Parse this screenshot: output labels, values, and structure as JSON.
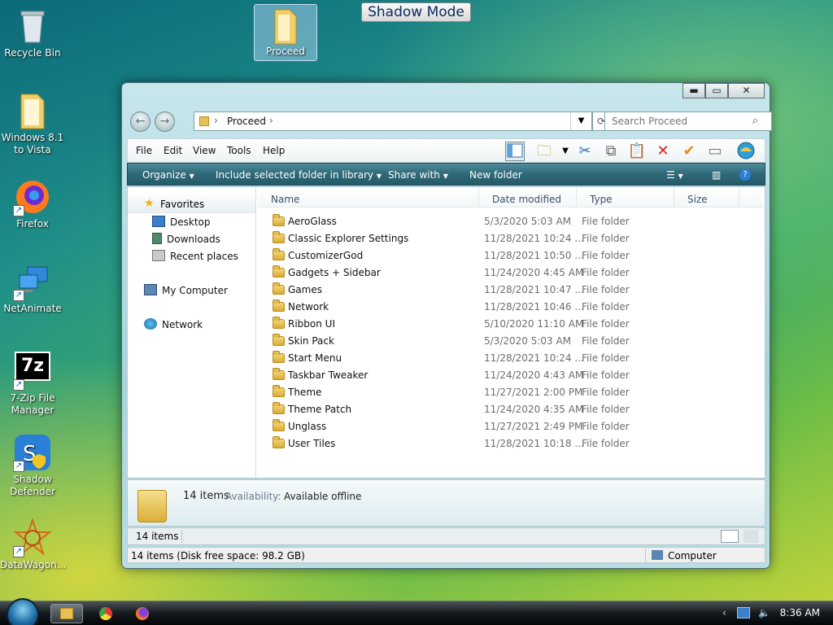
{
  "desktop": {
    "icons": [
      {
        "label": "Recycle Bin",
        "icon": "recycle-bin-icon"
      },
      {
        "label": "Windows 8.1 to Vista",
        "icon": "folder-icon"
      },
      {
        "label": "Firefox",
        "icon": "firefox-icon"
      },
      {
        "label": "NetAnimate",
        "icon": "network-computers-icon"
      },
      {
        "label": "7-Zip File Manager",
        "icon": "7zip-icon",
        "glyph": "7z"
      },
      {
        "label": "Shadow Defender",
        "icon": "shadow-defender-icon"
      },
      {
        "label": "DataWagon...",
        "icon": "datawagon-icon"
      },
      {
        "label": "Proceed",
        "icon": "folder-icon"
      }
    ],
    "shadow_mode": "Shadow Mode"
  },
  "window": {
    "controls": {
      "minimize": "▬",
      "maximize": "▭",
      "close": "✕"
    },
    "address": {
      "crumb": "Proceed",
      "separator": "›"
    },
    "search_placeholder": "Search Proceed",
    "menu": [
      "File",
      "Edit",
      "View",
      "Tools",
      "Help"
    ],
    "commands": [
      "Organize",
      "Include selected folder in library",
      "Share with",
      "New folder"
    ],
    "nav": {
      "favorites": "Favorites",
      "items": [
        "Desktop",
        "Downloads",
        "Recent places"
      ],
      "my_computer": "My Computer",
      "network": "Network"
    },
    "columns": [
      "Name",
      "Date modified",
      "Type",
      "Size"
    ],
    "files": [
      {
        "name": "AeroGlass",
        "date": "5/3/2020 5:03 AM",
        "type": "File folder"
      },
      {
        "name": "Classic Explorer Settings",
        "date": "11/28/2021 10:24 ...",
        "type": "File folder"
      },
      {
        "name": "CustomizerGod",
        "date": "11/28/2021 10:50 ...",
        "type": "File folder"
      },
      {
        "name": "Gadgets + Sidebar",
        "date": "11/24/2020 4:45 AM",
        "type": "File folder"
      },
      {
        "name": "Games",
        "date": "11/28/2021 10:47 ...",
        "type": "File folder"
      },
      {
        "name": "Network",
        "date": "11/28/2021 10:46 ...",
        "type": "File folder"
      },
      {
        "name": "Ribbon UI",
        "date": "5/10/2020 11:10 AM",
        "type": "File folder"
      },
      {
        "name": "Skin Pack",
        "date": "5/3/2020 5:03 AM",
        "type": "File folder"
      },
      {
        "name": "Start Menu",
        "date": "11/28/2021 10:24 ...",
        "type": "File folder"
      },
      {
        "name": "Taskbar Tweaker",
        "date": "11/24/2020 4:43 AM",
        "type": "File folder"
      },
      {
        "name": "Theme",
        "date": "11/27/2021 2:00 PM",
        "type": "File folder"
      },
      {
        "name": "Theme Patch",
        "date": "11/24/2020 4:35 AM",
        "type": "File folder"
      },
      {
        "name": "Unglass",
        "date": "11/27/2021 2:49 PM",
        "type": "File folder"
      },
      {
        "name": "User Tiles",
        "date": "11/28/2021 10:18 ...",
        "type": "File folder"
      }
    ],
    "details": {
      "count": "14 items",
      "availability_label": "Availability:",
      "availability_value": "Available offline"
    },
    "status": {
      "items": "14 items",
      "disk": "14 items (Disk free space: 98.2 GB)",
      "computer": "Computer"
    }
  },
  "taskbar": {
    "clock": "8:36 AM",
    "tray_chevron": "‹"
  }
}
